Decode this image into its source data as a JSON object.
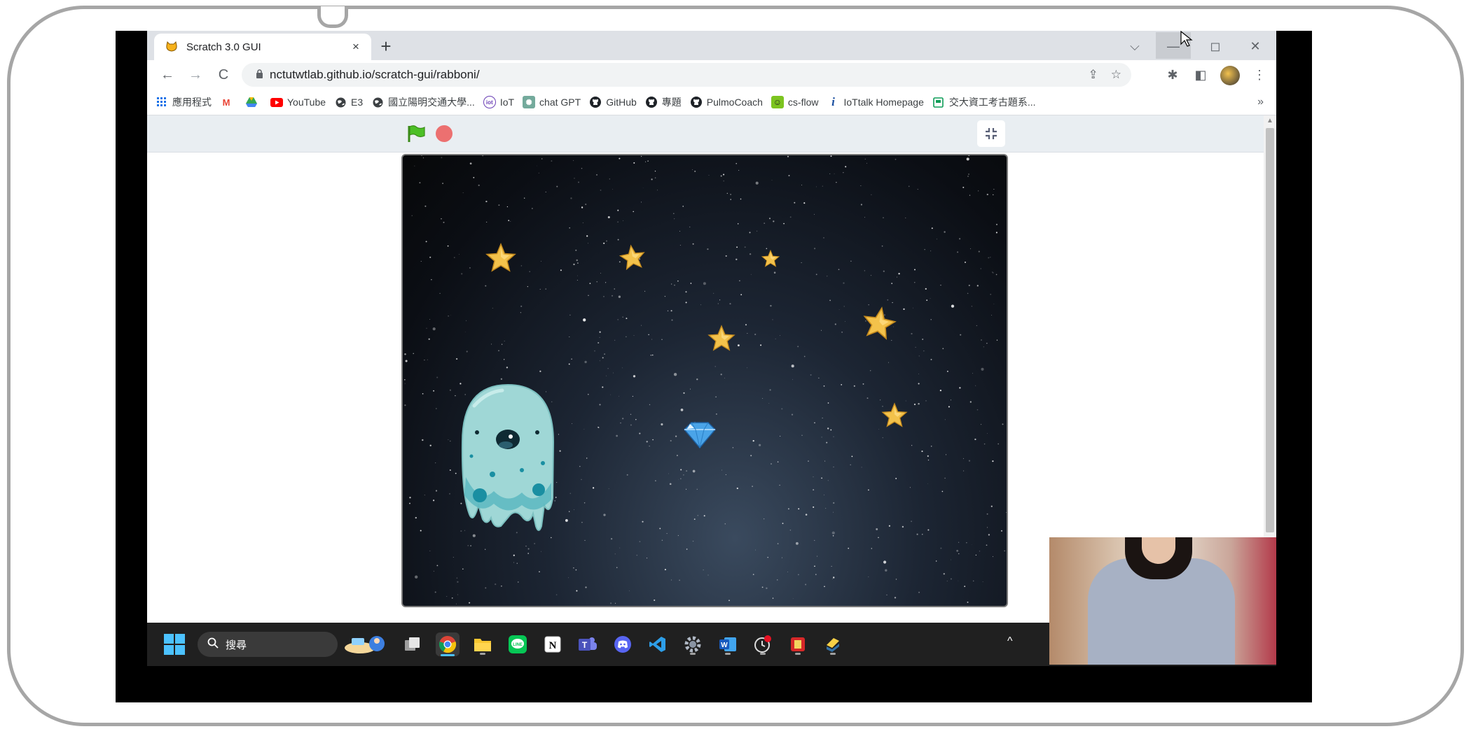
{
  "browser": {
    "tab_title": "Scratch 3.0 GUI",
    "tab_close": "×",
    "new_tab": "+",
    "window_controls": {
      "dropdown": "⌵",
      "minimize": "—",
      "restore": "◻",
      "close": "✕"
    },
    "nav": {
      "back": "←",
      "forward": "→",
      "reload": "C"
    },
    "url": "nctutwtlab.github.io/scratch-gui/rabboni/",
    "bookmarks": [
      {
        "label": "應用程式",
        "icon": "apps-grid-icon"
      },
      {
        "label": "",
        "icon": "gmail-icon"
      },
      {
        "label": "",
        "icon": "drive-icon"
      },
      {
        "label": "YouTube",
        "icon": "youtube-icon"
      },
      {
        "label": "E3",
        "icon": "globe-icon"
      },
      {
        "label": "國立陽明交通大學...",
        "icon": "globe-icon"
      },
      {
        "label": "IoT",
        "icon": "iot-icon"
      },
      {
        "label": "chat GPT",
        "icon": "chatgpt-icon"
      },
      {
        "label": "GitHub",
        "icon": "github-icon"
      },
      {
        "label": "專題",
        "icon": "github-icon"
      },
      {
        "label": "PulmoCoach",
        "icon": "github-icon"
      },
      {
        "label": "cs-flow",
        "icon": "csflow-icon"
      },
      {
        "label": "IoTtalk Homepage",
        "icon": "info-icon"
      },
      {
        "label": "交大資工考古題系...",
        "icon": "doc-icon"
      }
    ],
    "bookmarks_more": "»"
  },
  "taskbar": {
    "search_label": "搜尋",
    "tray_arrow": "^"
  },
  "colors": {
    "tabbar": "#dee1e6",
    "stage_header": "#e9eef2",
    "taskbar": "#202020",
    "accent": "#4cc2ff"
  }
}
